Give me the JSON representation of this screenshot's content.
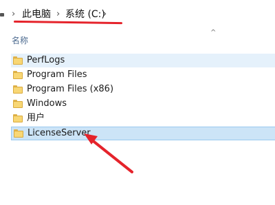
{
  "breadcrumb": {
    "items": [
      "此电脑",
      "系统 (C:)"
    ],
    "separator": "›"
  },
  "file_list": {
    "column_name_label": "名称",
    "sort_indicator": "^",
    "items": [
      {
        "name": "PerfLogs",
        "state": "hover"
      },
      {
        "name": "Program Files",
        "state": "normal"
      },
      {
        "name": "Program Files (x86)",
        "state": "normal"
      },
      {
        "name": "Windows",
        "state": "normal"
      },
      {
        "name": "用户",
        "state": "normal"
      },
      {
        "name": "LicenseServer",
        "state": "selected"
      }
    ]
  },
  "colors": {
    "annotation_red": "#e5232b",
    "hover_bg": "#e5f1fb",
    "selected_bg": "#cce4f7",
    "folder_yellow": "#f8d775"
  },
  "icons": [
    "drive-icon",
    "folder-icon"
  ]
}
